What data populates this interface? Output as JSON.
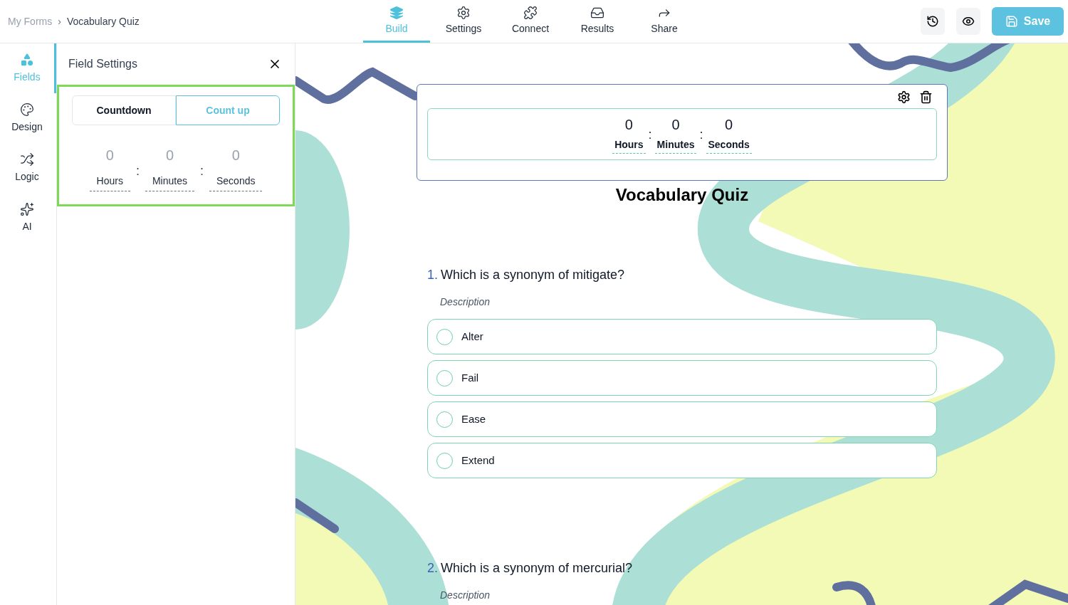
{
  "breadcrumb": {
    "items": [
      "My Forms",
      "Vocabulary Quiz"
    ],
    "separator": "›"
  },
  "nav_tabs": [
    {
      "label": "Build",
      "selected": true
    },
    {
      "label": "Settings",
      "selected": false
    },
    {
      "label": "Connect",
      "selected": false
    },
    {
      "label": "Results",
      "selected": false
    },
    {
      "label": "Share",
      "selected": false
    }
  ],
  "save_button": {
    "label": "Save"
  },
  "sidebar": {
    "items": [
      {
        "label": "Fields",
        "selected": true
      },
      {
        "label": "Design",
        "selected": false
      },
      {
        "label": "Logic",
        "selected": false
      },
      {
        "label": "AI",
        "selected": false
      }
    ]
  },
  "field_settings": {
    "title": "Field Settings",
    "mode_tabs": [
      {
        "label": "Countdown",
        "selected": false
      },
      {
        "label": "Count up",
        "selected": true
      }
    ],
    "separator": ":",
    "units": [
      {
        "value": "0",
        "label": "Hours"
      },
      {
        "value": "0",
        "label": "Minutes"
      },
      {
        "value": "0",
        "label": "Seconds"
      }
    ]
  },
  "timer_field": {
    "separator": ":",
    "units": [
      {
        "value": "0",
        "label": "Hours"
      },
      {
        "value": "0",
        "label": "Minutes"
      },
      {
        "value": "0",
        "label": "Seconds"
      }
    ]
  },
  "form_title": "Vocabulary Quiz",
  "questions": [
    {
      "number": "1.",
      "text": "Which is a synonym of mitigate?",
      "description": "Description",
      "options": [
        {
          "label": "Alter",
          "selected": false
        },
        {
          "label": "Fail",
          "selected": false
        },
        {
          "label": "Ease",
          "selected": false
        },
        {
          "label": "Extend",
          "selected": false
        }
      ]
    },
    {
      "number": "2.",
      "text": "Which is a synonym of mercurial?",
      "description": "Description"
    }
  ]
}
